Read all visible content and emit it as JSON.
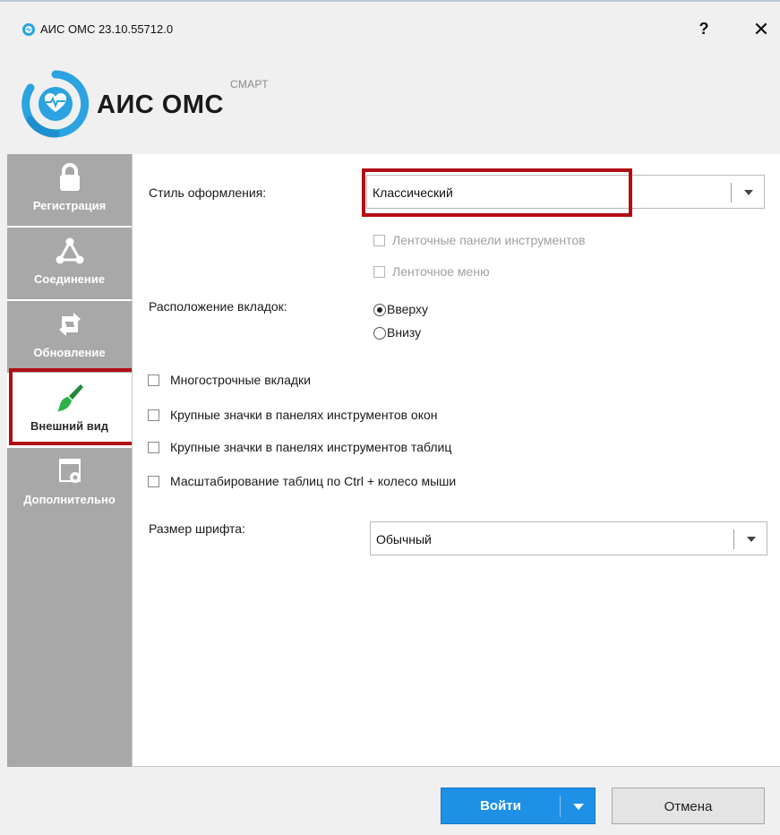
{
  "window": {
    "title": "АИС ОМС 23.10.55712.0",
    "help_label": "?",
    "close_label": "✕"
  },
  "logo": {
    "name": "АИС ОМС",
    "sup": "СМАРТ"
  },
  "sidebar": {
    "items": [
      {
        "label": "Регистрация",
        "icon": "lock-icon"
      },
      {
        "label": "Соединение",
        "icon": "network-icon"
      },
      {
        "label": "Обновление",
        "icon": "update-icon"
      },
      {
        "label": "Внешний вид",
        "icon": "paint-brush-icon",
        "active": true
      },
      {
        "label": "Дополнительно",
        "icon": "window-gear-icon"
      }
    ]
  },
  "appearance": {
    "style_label": "Стиль оформления:",
    "style_value": "Классический",
    "ribbon_panels_label": "Ленточные панели инструментов",
    "ribbon_menu_label": "Ленточное меню",
    "tabs_position_label": "Расположение вкладок:",
    "tabs_top_label": "Вверху",
    "tabs_bottom_label": "Внизу",
    "multiline_tabs_label": "Многострочные вкладки",
    "large_icons_windows_label": "Крупные значки в панелях инструментов окон",
    "large_icons_tables_label": "Крупные значки в панелях инструментов таблиц",
    "table_scaling_label": "Масштабирование таблиц по Ctrl + колесо мыши",
    "font_size_label": "Размер шрифта:",
    "font_size_value": "Обычный"
  },
  "footer": {
    "login_label": "Войти",
    "cancel_label": "Отмена"
  },
  "colors": {
    "accent": "#1e90e6",
    "highlight": "#b20d16",
    "sidebar": "#a8a8a8",
    "logo_blue": "#2aa3e0"
  }
}
